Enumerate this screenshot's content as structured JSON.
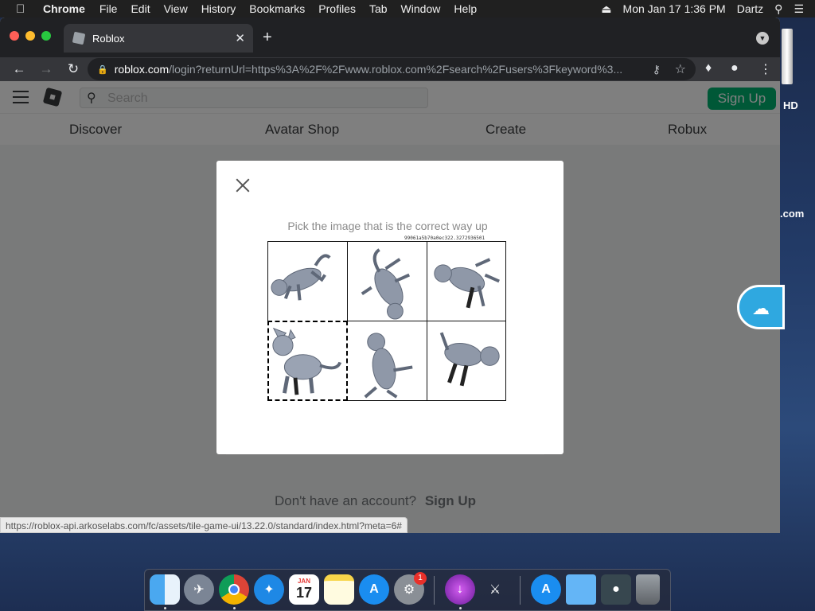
{
  "menubar": {
    "app_name": "Chrome",
    "items": [
      "File",
      "Edit",
      "View",
      "History",
      "Bookmarks",
      "Profiles",
      "Tab",
      "Window",
      "Help"
    ],
    "clock": "Mon Jan 17  1:36 PM",
    "user": "Dartz"
  },
  "desktop": {
    "drive_label": "HD",
    "item_label": ".com"
  },
  "browser": {
    "tab_title": "Roblox",
    "url_host": "roblox.com",
    "url_path": "/login?returnUrl=https%3A%2F%2Fwww.roblox.com%2Fsearch%2Fusers%3Fkeyword%3...",
    "status_url": "https://roblox-api.arkoselabs.com/fc/assets/tile-game-ui/13.22.0/standard/index.html?meta=6#"
  },
  "roblox": {
    "search_placeholder": "Search",
    "signup_label": "Sign Up",
    "nav": [
      "Discover",
      "Avatar Shop",
      "Create",
      "Robux"
    ],
    "no_account_text": "Don't have an account?",
    "no_account_link": "Sign Up"
  },
  "captcha": {
    "prompt": "Pick the image that is the correct way up",
    "challenge_id": "99061a5b70a0ec322.3272936501",
    "tiles": [
      {
        "id": 1,
        "selected": false
      },
      {
        "id": 2,
        "selected": false
      },
      {
        "id": 3,
        "selected": false
      },
      {
        "id": 4,
        "selected": true
      },
      {
        "id": 5,
        "selected": false
      },
      {
        "id": 6,
        "selected": false
      }
    ]
  },
  "dock": {
    "calendar_month": "JAN",
    "calendar_day": "17",
    "settings_badge": "1",
    "apps": [
      "Finder",
      "Launchpad",
      "Chrome",
      "Safari",
      "Calendar",
      "Notes",
      "App Store",
      "System Preferences",
      "Downloads",
      "Instruments",
      "App Store Downloads",
      "Folder",
      "Utility",
      "Trash"
    ]
  },
  "colors": {
    "signup_green": "#00b06f",
    "cloud_blue": "#2fa8e0"
  }
}
